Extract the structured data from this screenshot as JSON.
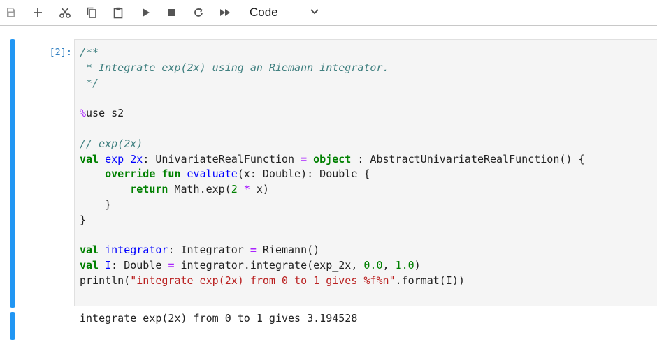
{
  "toolbar": {
    "buttons": [
      "save-icon",
      "add-icon",
      "cut-icon",
      "copy-icon",
      "paste-icon",
      "run-icon",
      "stop-icon",
      "restart-icon",
      "fast-forward-icon"
    ],
    "cell_type": "Code"
  },
  "cell": {
    "prompt": "[2]:",
    "code": {
      "l1": "/**",
      "l2": " * Integrate exp(2x) using an Riemann integrator.",
      "l3": " */",
      "magic_symbol": "%",
      "magic_rest": "use s2",
      "comment2": "// exp(2x)",
      "val": "val",
      "exp_name": "exp_2x",
      "l6_a": ": UnivariateRealFunction ",
      "eq": "=",
      "object": "object",
      "l6_b": " : AbstractUnivariateRealFunction() {",
      "override": "override",
      "fun": "fun",
      "evaluate": "evaluate",
      "l7_b": "(x: Double): Double {",
      "return": "return",
      "l8_a": " Math.exp(",
      "two": "2",
      "star": "*",
      "l8_b": " x)",
      "rb1": "    }",
      "rb2": "}",
      "integrator": "integrator",
      "l10_a": ": Integrator ",
      "l10_b": " Riemann()",
      "I": "I",
      "l11_a": ": Double ",
      "l11_b": " integrator.integrate(exp_2x, ",
      "n0": "0.0",
      "comma": ", ",
      "n1": "1.0",
      "close": ")",
      "println": "println(",
      "string": "\"integrate exp(2x) from 0 to 1 gives %f%n\"",
      "l12_b": ".format(I))"
    },
    "output": "integrate exp(2x) from 0 to 1 gives 3.194528"
  }
}
